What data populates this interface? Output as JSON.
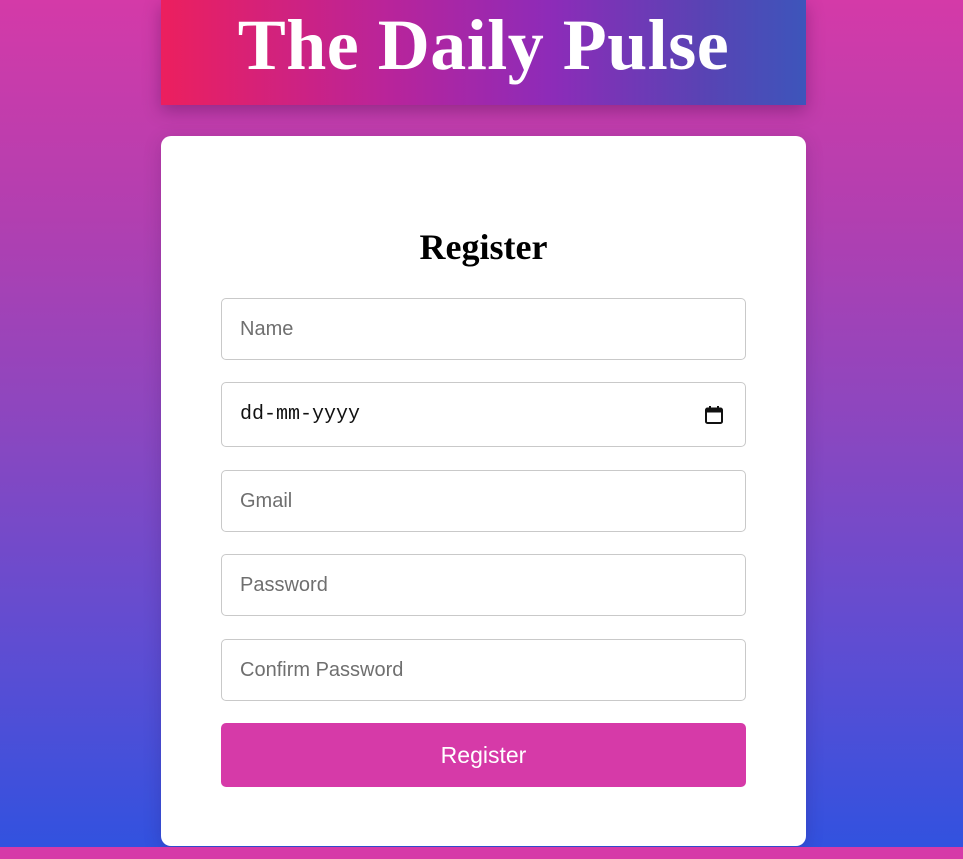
{
  "site": {
    "title": "The Daily Pulse"
  },
  "form": {
    "heading": "Register",
    "name_placeholder": "Name",
    "dob_placeholder": "dd-mm-yyyy",
    "gmail_placeholder": "Gmail",
    "password_placeholder": "Password",
    "confirm_password_placeholder": "Confirm Password",
    "submit_label": "Register"
  },
  "colors": {
    "accent": "#d63aa8",
    "banner_gradient_start": "#ec1f5e",
    "banner_gradient_end": "#3d55bb",
    "page_gradient_top": "#d43aa8",
    "page_gradient_bottom": "#2f52e0"
  },
  "icons": {
    "date_picker": "calendar-icon"
  }
}
